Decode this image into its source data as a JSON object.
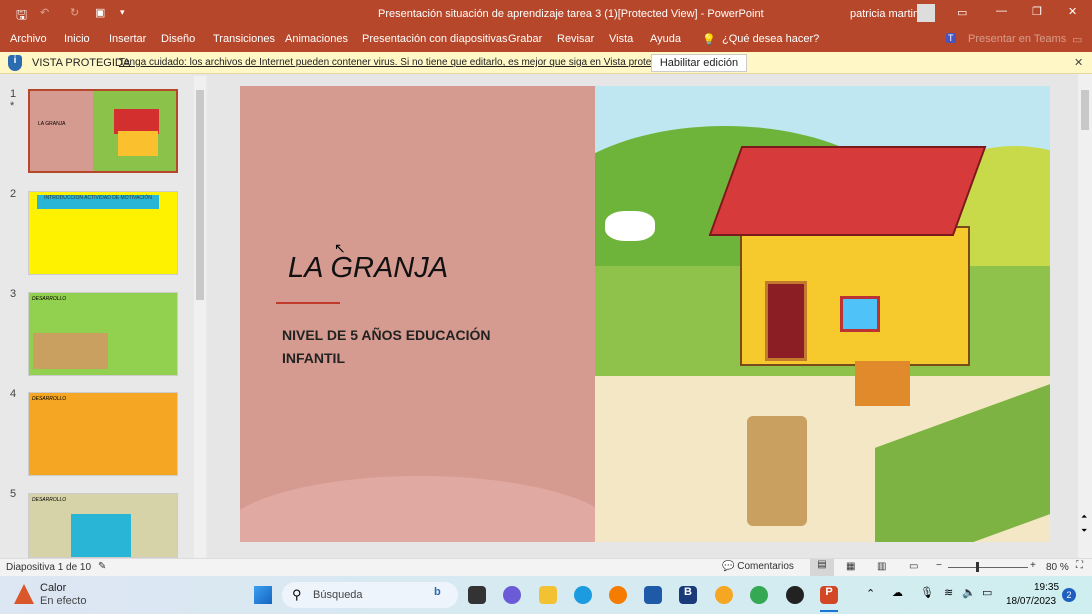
{
  "titlebar": {
    "title": "Presentación situación de aprendizaje tarea 3 (1)[Protected View]  -  PowerPoint",
    "user": "patricia martin"
  },
  "menu": [
    "Archivo",
    "Inicio",
    "Insertar",
    "Diseño",
    "Transiciones",
    "Animaciones",
    "Presentación con diapositivas",
    "Grabar",
    "Revisar",
    "Vista",
    "Ayuda"
  ],
  "tell_me": "¿Qué desea hacer?",
  "teams": "Presentar en Teams",
  "protected": {
    "label": "VISTA PROTEGIDA",
    "message": "Tenga cuidado: los archivos de Internet pueden contener virus. Si no tiene que editarlo, es mejor que siga en Vista protegida.",
    "button": "Habilitar edición"
  },
  "thumbnails": [
    {
      "num": "1",
      "title": "LA GRANJA",
      "bg": "#d59a90"
    },
    {
      "num": "2",
      "title": "INTRODUCCION ACTIVIDAD DE MOTIVACIÓN",
      "bg": "#fff200"
    },
    {
      "num": "3",
      "title": "DESARROLLO",
      "bg": "#92d050"
    },
    {
      "num": "4",
      "title": "DESARROLLO",
      "bg": "#f5a623"
    },
    {
      "num": "5",
      "title": "DESARROLLO",
      "bg": "#d6d3a8"
    }
  ],
  "slide": {
    "title": "LA GRANJA",
    "subtitle": "NIVEL DE 5 AÑOS EDUCACIÓN INFANTIL"
  },
  "status": {
    "slide_info": "Diapositiva 1 de 10",
    "comments": "Comentarios",
    "zoom": "80 %",
    "zoom_percent": 80
  },
  "taskbar": {
    "weather_title": "Calor",
    "weather_sub": "En efecto",
    "search": "Búsqueda",
    "time": "19:35",
    "date": "18/07/2023",
    "notifications": "2"
  }
}
